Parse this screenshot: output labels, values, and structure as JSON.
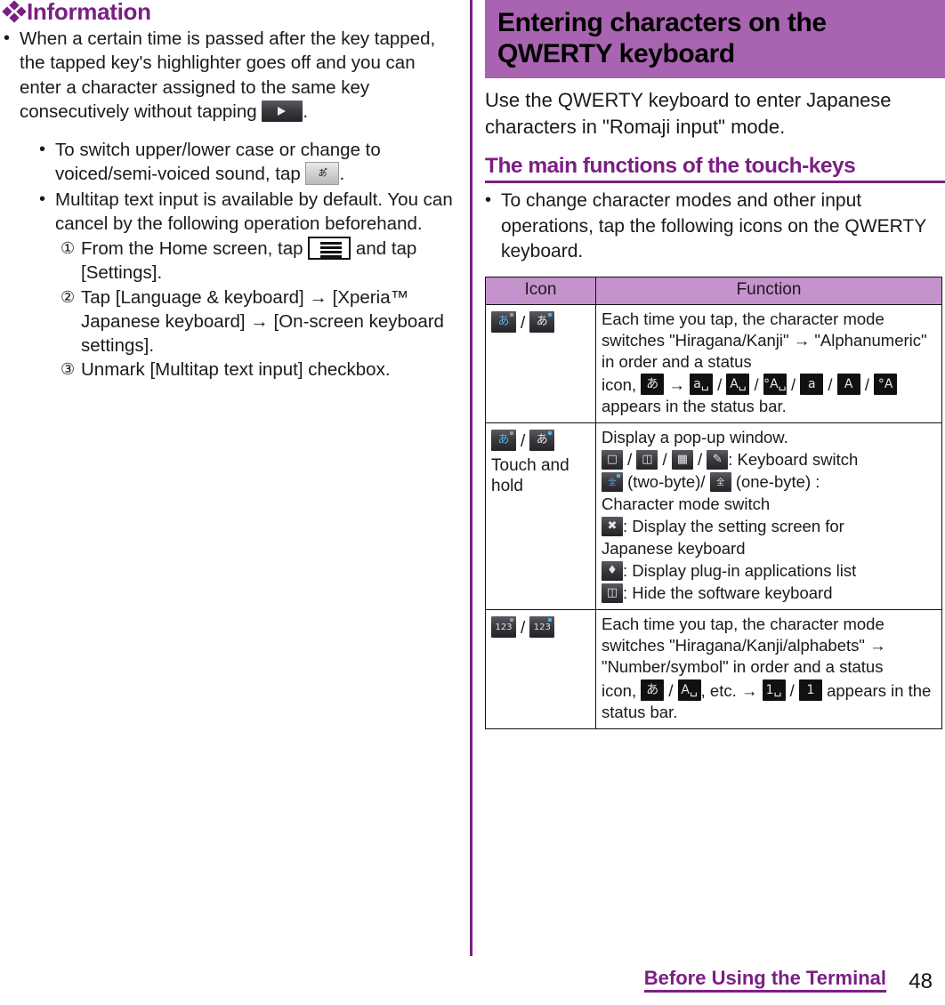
{
  "left_column": {
    "info_heading": "Information",
    "info_icon": "diamond-cluster-icon",
    "bullets": [
      {
        "text_before": "When a certain time is passed after the key tapped, the tapped key's highlighter goes off and you can enter a character assigned to the same key consecutively without tapping ",
        "icon": "next-key-icon",
        "text_after": "."
      }
    ],
    "sub_bullets": [
      {
        "text_before": "To switch upper/lower case or change to voiced/semi-voiced sound, tap ",
        "icon": "kana-toggle-key-icon",
        "text_after": "."
      },
      {
        "text_before": "Multitap text input is available by default. You can cancel by the following operation beforehand.",
        "icon": "",
        "text_after": ""
      }
    ],
    "steps": [
      {
        "number": "①",
        "text_before": "From the Home screen, tap ",
        "icon": "menu-key-icon",
        "text_after": " and tap [Settings]."
      },
      {
        "number": "②",
        "text_before": "Tap [Language & keyboard] → [Xperia™ Japanese keyboard] → [On-screen keyboard settings].",
        "icon": "",
        "text_after": ""
      },
      {
        "number": "③",
        "text_before": "Unmark [Multitap text input] checkbox.",
        "icon": "",
        "text_after": ""
      }
    ]
  },
  "right_column": {
    "chapter_banner": "Entering characters on the QWERTY keyboard",
    "lead_paragraph": "Use the QWERTY keyboard to enter Japanese characters in \"Romaji input\" mode.",
    "section_heading": "The main functions of the touch-keys",
    "section_bullets": [
      "To change character modes and other input operations, tap the following icons on the QWERTY keyboard."
    ],
    "table": {
      "headers": [
        "Icon",
        "Function"
      ],
      "rows": [
        {
          "icon_cell": {
            "icons": [
              "aA-blue-key-icon",
              "aA-gray-key-icon"
            ],
            "separator": "/",
            "sub_label": ""
          },
          "function_lines": [
            {
              "type": "text",
              "text": "Each time you tap, the character mode switches \"Hiragana/Kanji\" → \"Alphanumeric\" in order and a status"
            },
            {
              "type": "mixed",
              "prefix": "icon, ",
              "icons": [
                "あ",
                "a␣",
                "A␣",
                "°A␣",
                "a",
                "A",
                "°A"
              ],
              "suffix": " appears in the status bar.",
              "arrow_after_first": "→"
            }
          ]
        },
        {
          "icon_cell": {
            "icons": [
              "aA-blue-key-icon",
              "aA-gray-key-icon"
            ],
            "separator": "/",
            "sub_label": "Touch and hold"
          },
          "function_lines": [
            {
              "type": "text",
              "text": "Display a pop-up window."
            },
            {
              "type": "icons-label",
              "icons": [
                "phone-keypad-icon",
                "qwerty-keyboard-icon",
                "grid-keyboard-icon",
                "handwriting-icon"
              ],
              "label": ": Keyboard switch"
            },
            {
              "type": "byte-row",
              "icon_two_byte": "zenkaku-blue-icon",
              "text_two_byte": "(two-byte)/",
              "icon_one_byte": "zenkaku-gray-icon",
              "text_one_byte": "(one-byte) :"
            },
            {
              "type": "text",
              "text": "Character mode switch"
            },
            {
              "type": "icon-label",
              "icon": "tools-icon",
              "label": ": Display the setting screen for"
            },
            {
              "type": "text",
              "text": "Japanese keyboard"
            },
            {
              "type": "icon-label",
              "icon": "plugin-puzzle-icon",
              "label": ": Display plug-in applications list"
            },
            {
              "type": "icon-label",
              "icon": "hide-keyboard-icon",
              "label": ": Hide the software keyboard"
            }
          ]
        },
        {
          "icon_cell": {
            "icons": [
              "123-gray-key-icon",
              "123-blue-key-icon"
            ],
            "separator": "/",
            "sub_label": ""
          },
          "function_lines": [
            {
              "type": "text",
              "text": "Each time you tap, the character mode switches \"Hiragana/Kanji/alphabets\" → \"Number/symbol\" in order and a status"
            },
            {
              "type": "mixed2",
              "prefix": "icon, ",
              "icons": [
                "あ",
                "A␣"
              ],
              "mid": ", etc. →",
              "icons2": [
                "1␣",
                "1"
              ],
              "suffix": " appears in the status bar."
            }
          ]
        }
      ]
    }
  },
  "footer": {
    "chapter_title": "Before Using the Terminal",
    "page_number": "48"
  },
  "colors": {
    "accent_purple": "#7b1f84",
    "banner_purple": "#a864b0",
    "table_header_purple": "#c493cc",
    "text_black": "#1a1a1a"
  }
}
